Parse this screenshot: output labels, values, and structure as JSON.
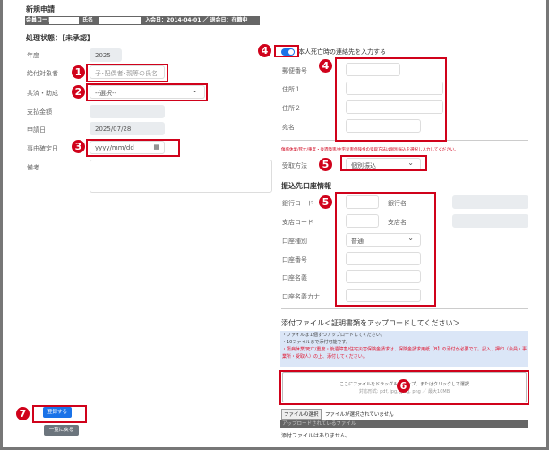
{
  "title": "新規申請",
  "member_bar": {
    "member_code_label": "会員コード",
    "name_label": "氏名",
    "join_info": "入会日：2014-04-01 ／ 退会日：在籍中"
  },
  "status": "処理状態：【未承認】",
  "left": {
    "year_label": "年度",
    "year_value": "2025",
    "recipient_label": "給付対象者",
    "recipient_placeholder": "子･配偶者･親等の氏名",
    "mutual_label": "共済・助成",
    "mutual_value": "--選択--",
    "amount_label": "支払金額",
    "apply_date_label": "申請日",
    "apply_date_value": "2025/07/28",
    "event_date_label": "事由確定日",
    "event_date_placeholder": "yyyy/mm/dd",
    "note_label": "備考"
  },
  "contact": {
    "toggle_label": "本人死亡時の連絡先を入力する",
    "toggle_on": true,
    "postal_label": "郵便番号",
    "addr1_label": "住所１",
    "addr2_label": "住所２",
    "addressee_label": "宛名"
  },
  "receive": {
    "warning": "傷病休業/死亡/重度・後遺障害/住宅災害保険金の受取方法は個別振込を選択し入力してください。",
    "method_label": "受取方法",
    "method_value": "個別振込"
  },
  "bank": {
    "heading": "振込先口座情報",
    "bank_code_label": "銀行コード",
    "bank_name_label": "銀行名",
    "branch_code_label": "支店コード",
    "branch_name_label": "支店名",
    "type_label": "口座種別",
    "type_value": "普通",
    "number_label": "口座番号",
    "holder_label": "口座名義",
    "holder_kana_label": "口座名義カナ"
  },
  "attach": {
    "heading": "添付ファイル＜証明書類をアップロードしてください＞",
    "note1": "・ファイルは１個ずつアップロードしてください。",
    "note2": "・10ファイルまで添付可能です。",
    "note3": "・傷病休業/死亡/重度・後遺障害/住宅災害保険金請求は、保険金請求用紙【B】の添付が必要です。記入、押印（会員・事業所・受取人）の上、添付してください。",
    "drop_text": "ここにファイルをドラッグ＆ドロップ、またはクリックして選択",
    "drop_formats": "対応形式: pdf, jpg, jpeg, png ／ 最大10MB",
    "choose_button": "ファイルの選択",
    "no_file": "ファイルが選択されていません",
    "uploaded_header": "アップロードされているファイル",
    "none": "添付ファイルはありません。"
  },
  "buttons": {
    "register": "登録する",
    "back": "一覧に戻る"
  },
  "markers": [
    "1",
    "2",
    "3",
    "4",
    "4",
    "5",
    "5",
    "6",
    "7"
  ]
}
